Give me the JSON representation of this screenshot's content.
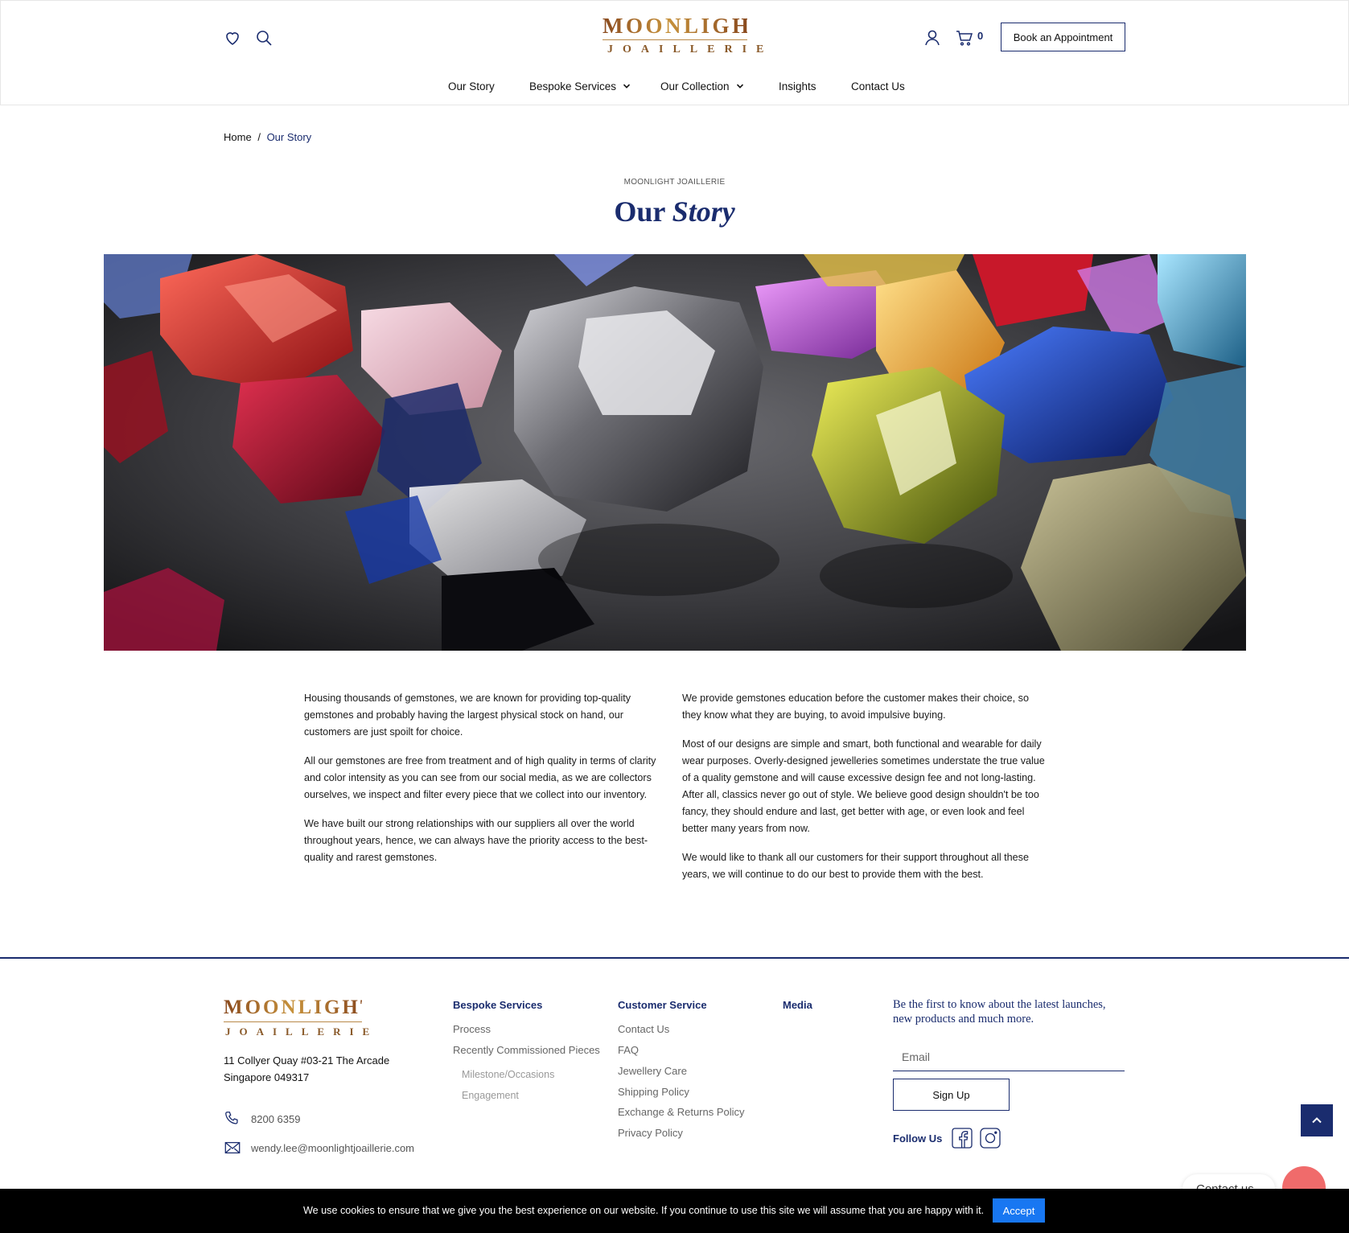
{
  "header": {
    "brand_top": "MOONLIGHT",
    "brand_bottom": "JOAILLERIE",
    "cart_count": "0",
    "book_label": "Book an Appointment",
    "nav": [
      {
        "label": "Our Story"
      },
      {
        "label": "Bespoke Services"
      },
      {
        "label": "Our Collection"
      },
      {
        "label": "Insights"
      },
      {
        "label": "Contact Us"
      }
    ]
  },
  "breadcrumb": {
    "home": "Home",
    "separator": "/",
    "current": "Our Story"
  },
  "page": {
    "eyebrow": "MOONLIGHT JOAILLERIE",
    "title_plain": "Our",
    "title_italic": "Story"
  },
  "content": {
    "left": [
      "Housing thousands of gemstones, we are known for providing top-quality gemstones and probably having the largest physical stock on hand, our customers are just spoilt for choice.",
      "All our gemstones are free from treatment and of high quality in terms of clarity and color intensity as you can see from our social media, as we are collectors ourselves, we inspect and filter every piece that we collect into our inventory.",
      "We have built our strong relationships with our suppliers all over the world throughout years, hence, we can always have the priority access to the best-quality and rarest gemstones."
    ],
    "right": [
      "We provide gemstones education before the customer makes their choice, so they know what they are buying, to avoid impulsive buying.",
      "Most of our designs are simple and smart, both functional and wearable for daily wear purposes. Overly-designed jewelleries sometimes understate the true value of a quality gemstone and will cause excessive design fee and not long-lasting. After all, classics never go out of style. We believe good design shouldn't be too fancy, they should endure and last, get better with age, or even look and feel better many years from now.",
      "We would like to thank all our customers for their support throughout all these years, we will continue to do our best to provide them with the best."
    ]
  },
  "footer": {
    "brand_top": "MOONLIGHT",
    "brand_bottom": "JOAILLERIE",
    "address_line1": "11 Collyer Quay #03-21 The Arcade",
    "address_line2": "Singapore 049317",
    "phone": "8200 6359",
    "email": "wendy.lee@moonlightjoaillerie.com",
    "bespoke": {
      "heading": "Bespoke Services",
      "links": [
        "Process",
        "Recently Commissioned Pieces"
      ],
      "sublinks": [
        "Milestone/Occasions",
        "Engagement"
      ]
    },
    "customer": {
      "heading": "Customer Service",
      "links": [
        "Contact Us",
        "FAQ",
        "Jewellery Care",
        "Shipping Policy",
        "Exchange & Returns Policy",
        "Privacy Policy"
      ]
    },
    "media": {
      "heading": "Media"
    },
    "newsletter": {
      "text": "Be the first to know about the latest launches, new products and much more.",
      "email_placeholder": "Email",
      "signup_label": "Sign Up"
    },
    "follow_label": "Follow Us"
  },
  "contact_widget": {
    "label": "Contact us"
  },
  "cookie": {
    "text": "We use cookies to ensure that we give you the best experience on our website. If you continue to use this site we will assume that you are happy with it.",
    "accept_label": "Accept"
  },
  "colors": {
    "navy": "#1a2c6e",
    "gold": "#a86b2c",
    "accept_blue": "#1877f2",
    "cookie_bg": "#000000"
  },
  "icons": [
    "heart-icon",
    "search-icon",
    "user-icon",
    "cart-icon",
    "chevron-down-icon",
    "phone-icon",
    "mail-icon",
    "facebook-icon",
    "instagram-icon",
    "arrow-up-icon",
    "chat-icon"
  ]
}
